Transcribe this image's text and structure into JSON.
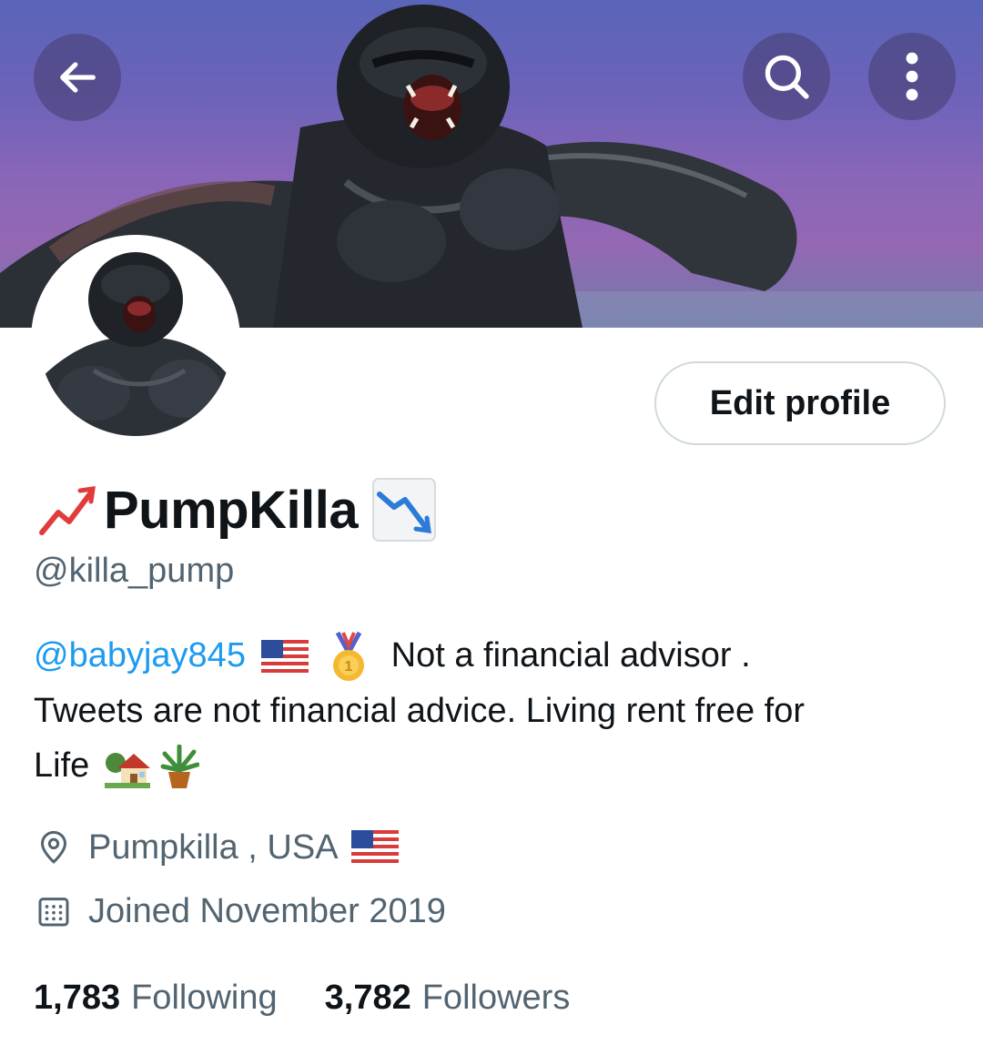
{
  "header": {
    "back_icon": "arrow-left-icon",
    "search_icon": "search-icon",
    "more_icon": "more-vertical-icon"
  },
  "profile": {
    "display_name": "PumpKilla",
    "name_prefix_emoji": "chart-increasing",
    "name_suffix_emoji": "chart-decreasing",
    "handle": "@killa_pump",
    "edit_button_label": "Edit profile",
    "bio": {
      "mention": "@babyjay845",
      "text_line1": "Not a financial advisor .",
      "text_line2": "Tweets are not financial advice. Living rent free for",
      "text_line3": "Life",
      "emojis": [
        "flag-us",
        "first-place-medal",
        "house-with-garden",
        "potted-plant"
      ]
    },
    "location": "Pumpkilla , USA",
    "location_emoji": "flag-us",
    "joined": "Joined November 2019",
    "following_count": "1,783",
    "following_label": "Following",
    "followers_count": "3,782",
    "followers_label": "Followers"
  },
  "colors": {
    "link": "#1d9bf0",
    "secondary_text": "#536471",
    "primary_text": "#0f1419",
    "button_border": "#cfd9de"
  }
}
